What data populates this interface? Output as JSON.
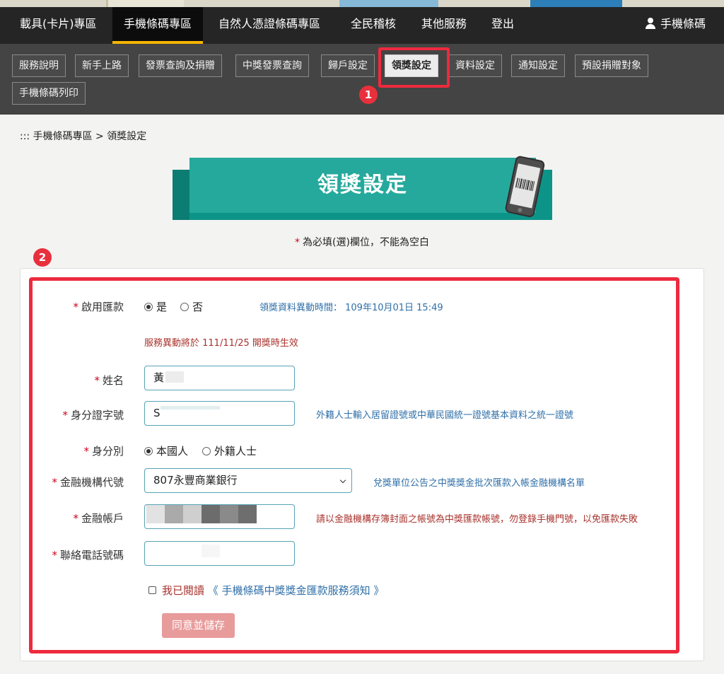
{
  "main_nav": {
    "items": [
      "載具(卡片)專區",
      "手機條碼專區",
      "自然人憑證條碼專區",
      "全民稽核",
      "其他服務",
      "登出"
    ],
    "user": "手機條碼"
  },
  "sub_nav": {
    "tabs": [
      "服務說明",
      "新手上路",
      "發票查詢及捐贈",
      "中獎發票查詢",
      "歸戶設定",
      "領獎設定",
      "資料設定",
      "通知設定",
      "預設捐贈對象",
      "手機條碼列印"
    ]
  },
  "badges": [
    "1",
    "2"
  ],
  "breadcrumb": "::: 手機條碼專區 > 領獎設定",
  "banner_title": "領獎設定",
  "required_note": {
    "star": "*",
    "text": "為必填(選)欄位，不能為空白"
  },
  "form": {
    "enable_label": "啟用匯款",
    "enable_options": [
      "是",
      "否"
    ],
    "change_time": "領獎資料異動時間： 109年10月01日 15:49",
    "effective_note": "服務異動將於 111/11/25 開獎時生效",
    "name_label": "姓名",
    "name_value": "黃",
    "id_label": "身分證字號",
    "id_value": "S",
    "id_hint": "外籍人士輸入居留證號或中華民國統一證號基本資料之統一證號",
    "identity_label": "身分別",
    "identity_options": [
      "本國人",
      "外籍人士"
    ],
    "bank_label": "金融機構代號",
    "bank_value": "807永豐商業銀行",
    "bank_hint": "兌獎單位公告之中獎獎金批次匯款入帳金融機構名單",
    "account_label": "金融帳戶",
    "account_hint": "請以金融機構存簿封面之帳號為中獎匯款帳號，勿登錄手機門號，以免匯款失敗",
    "phone_label": "聯絡電話號碼",
    "agree_prefix": "我已閱讀",
    "agree_link": "《 手機條碼中獎獎金匯款服務須知 》",
    "save_button": "同意並儲存"
  },
  "colors": {
    "required_star": "#d0021b",
    "highlight": "#ee2a3e",
    "banner": "#26a99d",
    "nav_active_bar": "#f5b400"
  }
}
